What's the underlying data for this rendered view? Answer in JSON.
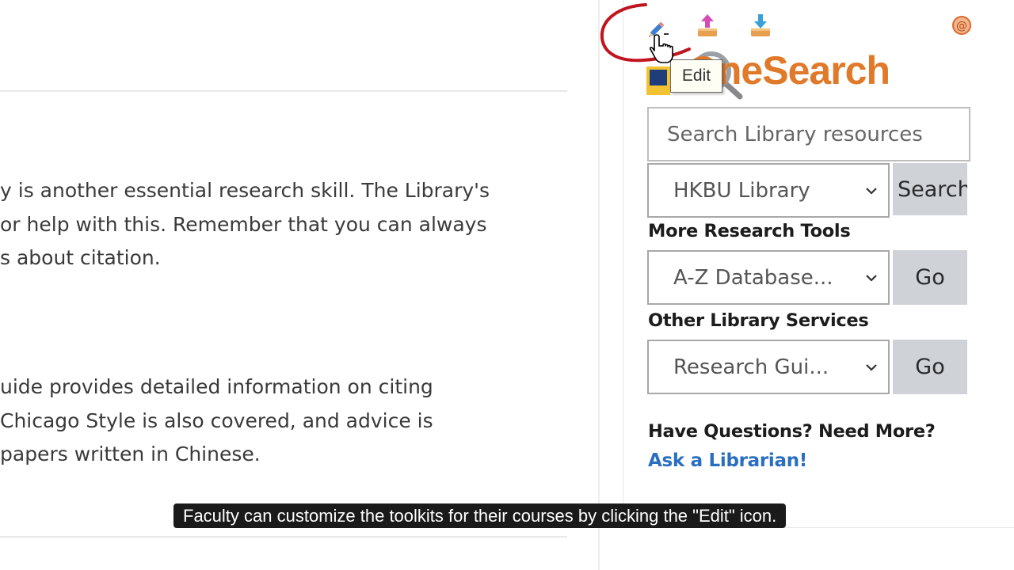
{
  "content": {
    "paragraph1": [
      "y is another essential research skill. The Library's",
      "or help with this. Remember that you can always",
      "s about citation."
    ],
    "paragraph2": [
      "uide provides detailed information on citing",
      " Chicago Style is also covered, and advice is",
      "papers written in Chinese."
    ]
  },
  "toolbar": {
    "icons": [
      "edit-pencil-icon",
      "upload-icon",
      "download-icon",
      "email-icon"
    ],
    "tooltip": "Edit"
  },
  "onesearch": {
    "logo_text": "OneSearch",
    "search_placeholder": "Search Library resources",
    "scope_selected": "HKBU Library",
    "search_button": "Search"
  },
  "research_tools": {
    "heading": "More Research Tools",
    "selected": "A-Z Database...",
    "go_button": "Go"
  },
  "library_services": {
    "heading": "Other Library Services",
    "selected": "Research Gui...",
    "go_button": "Go"
  },
  "help": {
    "heading": "Have Questions? Need More?",
    "link": "Ask a Librarian!"
  },
  "caption": "Faculty can customize the toolkits for their courses by clicking the \"Edit\" icon.",
  "colors": {
    "accent_orange": "#e07a2a",
    "link_blue": "#2a6ec0",
    "annotation_red": "#c0151f",
    "button_gray": "#cfd3d8"
  }
}
